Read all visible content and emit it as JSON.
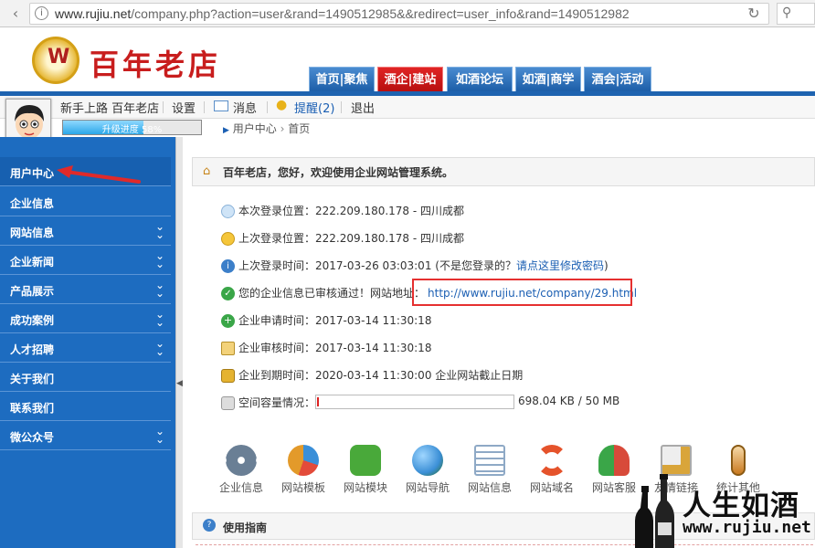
{
  "browser": {
    "url_host": "www.rujiu.net",
    "url_path": "/company.php?action=user&rand=1490512985&&redirect=user_info&rand=1490512982"
  },
  "header": {
    "logo_text": "百年老店",
    "tabs": [
      {
        "label": "首页|聚焦"
      },
      {
        "label": "酒企|建站"
      },
      {
        "label": "如酒论坛"
      },
      {
        "label": "如酒|商学"
      },
      {
        "label": "酒会|活动"
      }
    ]
  },
  "userbar": {
    "username": "新手上路 百年老店",
    "settings": "设置",
    "messages": "消息",
    "reminders": "提醒(2)",
    "logout": "退出",
    "progress_label": "升级进度 58%",
    "progress_value": 0.58
  },
  "breadcrumb": {
    "home": "用户中心",
    "current": "首页"
  },
  "sidebar": {
    "items": [
      {
        "label": "用户中心"
      },
      {
        "label": "企业信息"
      },
      {
        "label": "网站信息"
      },
      {
        "label": "企业新闻"
      },
      {
        "label": "产品展示"
      },
      {
        "label": "成功案例"
      },
      {
        "label": "人才招聘"
      },
      {
        "label": "关于我们"
      },
      {
        "label": "联系我们"
      },
      {
        "label": "微公众号"
      }
    ]
  },
  "welcome": "百年老店，您好，欢迎使用企业网站管理系统。",
  "info": {
    "this_login": "本次登录位置：222.209.180.178 - 四川成都",
    "last_login_location": "上次登录位置：222.209.180.178 - 四川成都",
    "last_login_time": "上次登录时间：2017-03-26 03:03:01 (不是您登录的？",
    "change_pwd_link": "请点这里修改密码",
    "change_pwd_close": ")",
    "approved": "您的企业信息已审核通过！网站地址：",
    "site_url": "http://www.rujiu.net/company/29.html",
    "apply_time": "企业申请时间：2017-03-14 11:30:18",
    "review_time": "企业审核时间：2017-03-14 11:30:18",
    "expire_time": "企业到期时间：2020-03-14 11:30:00 企业网站截止日期",
    "capacity_label": "空间容量情况：",
    "capacity_value": "698.04 KB / 50 MB"
  },
  "tools": [
    {
      "label": "企业信息",
      "icon": "gear-icon",
      "color": "#6a7f95"
    },
    {
      "label": "网站模板",
      "icon": "pie-chart-icon",
      "color": "#e39a2a"
    },
    {
      "label": "网站模块",
      "icon": "puzzle-icon",
      "color": "#49a93a"
    },
    {
      "label": "网站导航",
      "icon": "globe-icon",
      "color": "#3b8fd6"
    },
    {
      "label": "网站信息",
      "icon": "document-icon",
      "color": "#8ea9c6"
    },
    {
      "label": "网站域名",
      "icon": "lifebuoy-icon",
      "color": "#e5532b"
    },
    {
      "label": "网站客服",
      "icon": "users-icon",
      "color": "#d84a3a"
    },
    {
      "label": "友情链接",
      "icon": "settings-doc-icon",
      "color": "#d9a53a"
    },
    {
      "label": "统计其他",
      "icon": "thermometer-icon",
      "color": "#c9791f"
    }
  ],
  "guide_title": "使用指南",
  "watermark": {
    "cn": "人生如酒",
    "en": "www.rujiu.net"
  }
}
